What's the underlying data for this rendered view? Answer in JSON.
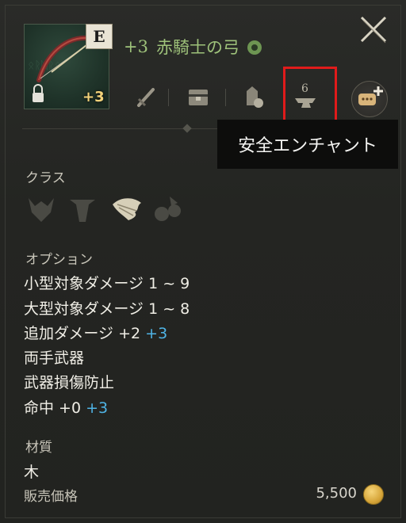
{
  "item": {
    "grade": "E",
    "enchant_badge": "+3",
    "title_level": "+3",
    "title_name": "赤騎士の弓"
  },
  "toolbar": {
    "icons": [
      "sword-icon",
      "chest-icon",
      "bag-icon",
      "anvil-icon",
      "chat-plus-icon"
    ]
  },
  "tooltip": {
    "text": "安全エンチャント"
  },
  "sections": {
    "class_label": "クラス",
    "option_label": "オプション",
    "material_label": "材質",
    "price_label": "販売価格"
  },
  "options": [
    {
      "text": "小型対象ダメージ 1 ~ 9",
      "bonus": ""
    },
    {
      "text": "大型対象ダメージ 1 ~ 8",
      "bonus": ""
    },
    {
      "text": "追加ダメージ +2",
      "bonus": "+3"
    },
    {
      "text": "両手武器",
      "bonus": ""
    },
    {
      "text": "武器損傷防止",
      "bonus": ""
    },
    {
      "text": "命中 +0",
      "bonus": "+3"
    }
  ],
  "material": {
    "value": "木"
  },
  "price": {
    "value": "5,500"
  },
  "colors": {
    "title": "#9ec27a",
    "bonus": "#4fb4e6",
    "highlight": "#e01b1b",
    "enchant": "#f2d27a"
  }
}
